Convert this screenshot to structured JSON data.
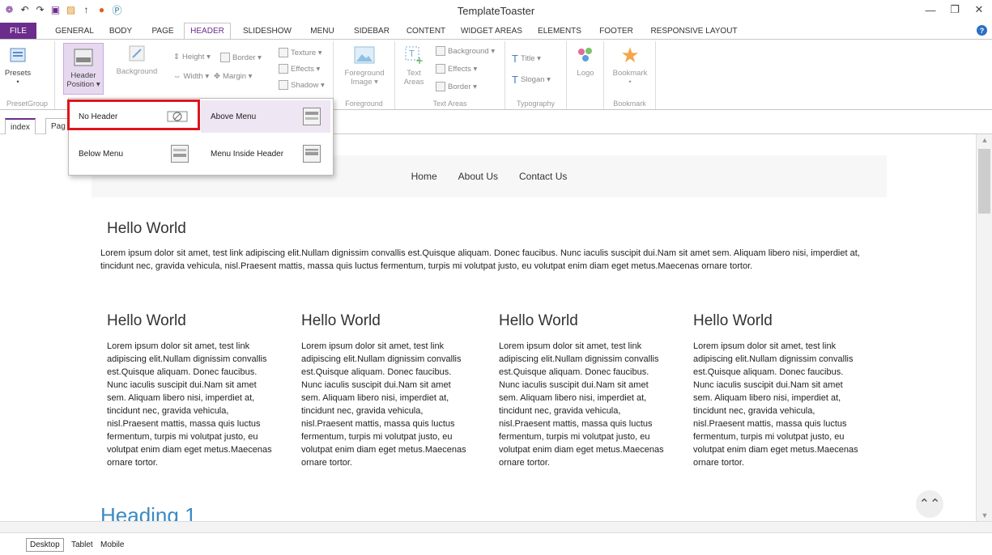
{
  "window": {
    "title": "TemplateToaster"
  },
  "ribbon_tabs": [
    "FILE",
    "GENERAL",
    "BODY",
    "PAGE",
    "HEADER",
    "SLIDESHOW",
    "MENU",
    "SIDEBAR",
    "CONTENT",
    "WIDGET AREAS",
    "ELEMENTS",
    "FOOTER",
    "RESPONSIVE LAYOUT"
  ],
  "active_ribbon_tab": "HEADER",
  "ribbon": {
    "presets": {
      "label": "Presets",
      "group": "PresetGroup"
    },
    "header_position": {
      "line1": "Header",
      "line2": "Position ▾"
    },
    "background": {
      "label": "Background"
    },
    "size": {
      "height": "Height ▾",
      "border": "Border ▾",
      "width": "Width ▾",
      "margin": "Margin ▾"
    },
    "texture": {
      "texture": "Texture ▾",
      "effects": "Effects ▾",
      "shadow": "Shadow ▾"
    },
    "foreground": {
      "line1": "Foreground",
      "line2": "Image ▾",
      "group": "Foreground"
    },
    "text_areas": {
      "line1": "Text",
      "line2": "Areas",
      "background": "Background ▾",
      "effects": "Effects ▾",
      "border": "Border ▾",
      "group": "Text Areas"
    },
    "typography": {
      "title": "Title ▾",
      "slogan": "Slogan ▾",
      "group": "Typography"
    },
    "logo": {
      "label": "Logo"
    },
    "bookmark": {
      "label": "Bookmark",
      "group": "Bookmark"
    }
  },
  "header_position_menu": {
    "options": [
      {
        "label": "No Header"
      },
      {
        "label": "Above Menu"
      },
      {
        "label": "Below Menu"
      },
      {
        "label": "Menu Inside Header"
      }
    ]
  },
  "doc_tabs": [
    "index",
    "Pag"
  ],
  "site": {
    "menu": [
      "Home",
      "About Us",
      "Contact Us"
    ],
    "main_heading": "Hello World",
    "main_text": "Lorem ipsum dolor sit amet, test link adipiscing elit.Nullam dignissim convallis est.Quisque aliquam. Donec faucibus. Nunc iaculis suscipit dui.Nam sit amet sem. Aliquam libero nisi, imperdiet at, tincidunt nec, gravida vehicula, nisl.Praesent mattis, massa quis luctus fermentum, turpis mi volutpat justo, eu volutpat enim diam eget metus.Maecenas ornare tortor.",
    "columns": [
      {
        "heading": "Hello World",
        "text": " Lorem ipsum dolor sit amet, test link adipiscing elit.Nullam dignissim convallis est.Quisque aliquam. Donec faucibus. Nunc iaculis suscipit dui.Nam sit amet sem. Aliquam libero nisi, imperdiet at, tincidunt nec, gravida vehicula, nisl.Praesent mattis, massa quis luctus fermentum, turpis mi volutpat justo, eu volutpat enim diam eget metus.Maecenas ornare tortor."
      },
      {
        "heading": "Hello World",
        "text": " Lorem ipsum dolor sit amet, test link adipiscing elit.Nullam dignissim convallis est.Quisque aliquam. Donec faucibus. Nunc iaculis suscipit dui.Nam sit amet sem. Aliquam libero nisi, imperdiet at, tincidunt nec, gravida vehicula, nisl.Praesent mattis, massa quis luctus fermentum, turpis mi volutpat justo, eu volutpat enim diam eget metus.Maecenas ornare tortor."
      },
      {
        "heading": "Hello World",
        "text": " Lorem ipsum dolor sit amet, test link adipiscing elit.Nullam dignissim convallis est.Quisque aliquam. Donec faucibus. Nunc iaculis suscipit dui.Nam sit amet sem. Aliquam libero nisi, imperdiet at, tincidunt nec, gravida vehicula, nisl.Praesent mattis, massa quis luctus fermentum, turpis mi volutpat justo, eu volutpat enim diam eget metus.Maecenas ornare tortor."
      },
      {
        "heading": "Hello World",
        "text": " Lorem ipsum dolor sit amet, test link adipiscing elit.Nullam dignissim convallis est.Quisque aliquam. Donec faucibus. Nunc iaculis suscipit dui.Nam sit amet sem. Aliquam libero nisi, imperdiet at, tincidunt nec, gravida vehicula, nisl.Praesent mattis, massa quis luctus fermentum, turpis mi volutpat justo, eu volutpat enim diam eget metus.Maecenas ornare tortor."
      }
    ],
    "heading1": "Heading 1"
  },
  "view_tabs": [
    "Desktop",
    "Tablet",
    "Mobile"
  ],
  "colors": {
    "accent": "#6c2c8c",
    "highlight_box": "#e0141c",
    "heading_link": "#3b8ac4"
  }
}
